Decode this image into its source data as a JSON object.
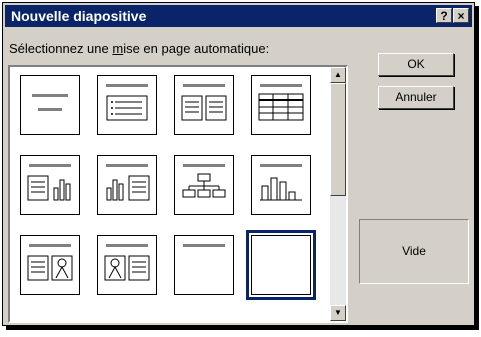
{
  "window": {
    "title": "Nouvelle diapositive",
    "help_label": "?",
    "close_label": "×"
  },
  "instruction": {
    "before": "Sélectionnez une ",
    "underlined": "m",
    "after": "ise en page automatique:"
  },
  "buttons": {
    "ok_label": "OK",
    "cancel_label": "Annuler"
  },
  "preview": {
    "label": "Vide"
  },
  "layouts": [
    {
      "id": "title-slide"
    },
    {
      "id": "bulleted-list"
    },
    {
      "id": "two-column-text"
    },
    {
      "id": "table"
    },
    {
      "id": "text-and-chart"
    },
    {
      "id": "chart-and-text"
    },
    {
      "id": "organization-chart"
    },
    {
      "id": "chart"
    },
    {
      "id": "text-and-clip-art"
    },
    {
      "id": "clip-art-and-text"
    },
    {
      "id": "title-only"
    },
    {
      "id": "blank",
      "selected": true
    }
  ]
}
